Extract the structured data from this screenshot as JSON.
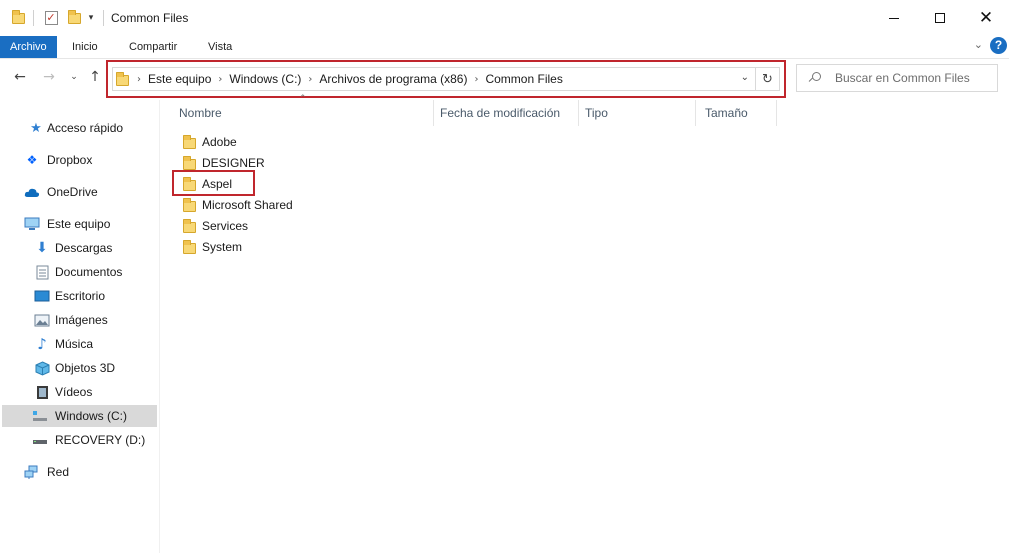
{
  "window": {
    "title": "Common Files",
    "qa_toolbar_dropdown": "▾"
  },
  "ribbon": {
    "tabs": [
      {
        "label": "Archivo",
        "active": true
      },
      {
        "label": "Inicio"
      },
      {
        "label": "Compartir"
      },
      {
        "label": "Vista"
      }
    ],
    "help": "?"
  },
  "nav": {
    "back": "←",
    "forward": "→",
    "recent": "⌄",
    "up": "↑"
  },
  "address": {
    "breadcrumbs": [
      "Este equipo",
      "Windows (C:)",
      "Archivos de programa (x86)",
      "Common Files"
    ],
    "refresh": "↻",
    "chevron": "⌄"
  },
  "search": {
    "placeholder": "Buscar en Common Files"
  },
  "sidebar": {
    "items": [
      {
        "label": "Acceso rápido",
        "icon": "star-icon"
      },
      {
        "label": "Dropbox",
        "icon": "dropbox-icon"
      },
      {
        "label": "OneDrive",
        "icon": "cloud-icon"
      },
      {
        "label": "Este equipo",
        "icon": "computer-icon"
      },
      {
        "label": "Descargas",
        "icon": "download-icon"
      },
      {
        "label": "Documentos",
        "icon": "document-icon"
      },
      {
        "label": "Escritorio",
        "icon": "desktop-icon"
      },
      {
        "label": "Imágenes",
        "icon": "image-icon"
      },
      {
        "label": "Música",
        "icon": "music-icon"
      },
      {
        "label": "Objetos 3D",
        "icon": "cube-icon"
      },
      {
        "label": "Vídeos",
        "icon": "video-icon"
      },
      {
        "label": "Windows (C:)",
        "icon": "drive-icon",
        "selected": true
      },
      {
        "label": "RECOVERY (D:)",
        "icon": "drive-icon"
      },
      {
        "label": "Red",
        "icon": "network-icon"
      }
    ]
  },
  "columns": [
    "Nombre",
    "Fecha de modificación",
    "Tipo",
    "Tamaño"
  ],
  "files": [
    {
      "name": "Adobe"
    },
    {
      "name": "DESIGNER"
    },
    {
      "name": "Aspel"
    },
    {
      "name": "Microsoft Shared"
    },
    {
      "name": "Services"
    },
    {
      "name": "System"
    }
  ],
  "colors": {
    "accent": "#1a6ec2",
    "highlight": "#c0262d",
    "folder": "#f8d876"
  }
}
